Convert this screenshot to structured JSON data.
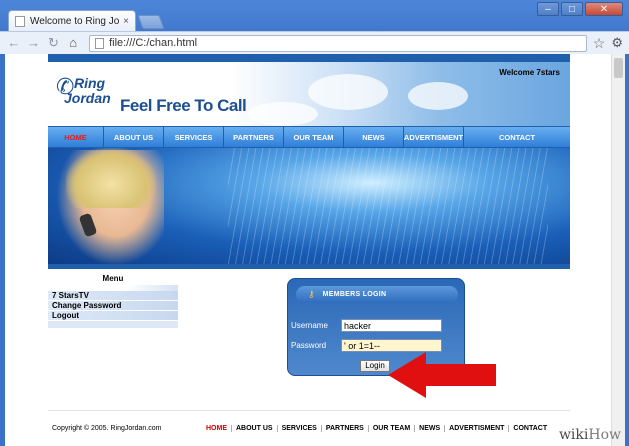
{
  "browser": {
    "tab_title": "Welcome to Ring Jordan",
    "tab_close": "×",
    "url": "file:///C:/chan.html",
    "window_buttons": [
      "–",
      "□",
      "✕"
    ]
  },
  "site": {
    "logo_line1": "Ring",
    "logo_line2": "Jordan",
    "tagline": "Feel Free To Call",
    "welcome": "Welcome 7stars",
    "nav": [
      "HOME",
      "ABOUT US",
      "SERVICES",
      "PARTNERS",
      "OUR TEAM",
      "NEWS",
      "ADVERTISMENT",
      "CONTACT"
    ],
    "menu": {
      "title": "Menu",
      "items": [
        "7 StarsTV",
        "Change Password",
        "Logout"
      ]
    },
    "login": {
      "title": "MEMBERS LOGIN",
      "username_label": "Username",
      "username_value": "hacker",
      "password_label": "Password",
      "password_value": "' or 1=1--",
      "button": "Login"
    },
    "footer": {
      "copyright": "Copyright © 2005. RingJordan.com",
      "links": [
        "HOME",
        "ABOUT US",
        "SERVICES",
        "PARTNERS",
        "OUR TEAM",
        "NEWS",
        "ADVERTISMENT",
        "CONTACT"
      ]
    }
  },
  "watermark": {
    "part1": "wiki",
    "part2": "How"
  },
  "colors": {
    "accent": "#2f7ed8",
    "nav_active": "#dd2222",
    "arrow": "#e01010"
  }
}
